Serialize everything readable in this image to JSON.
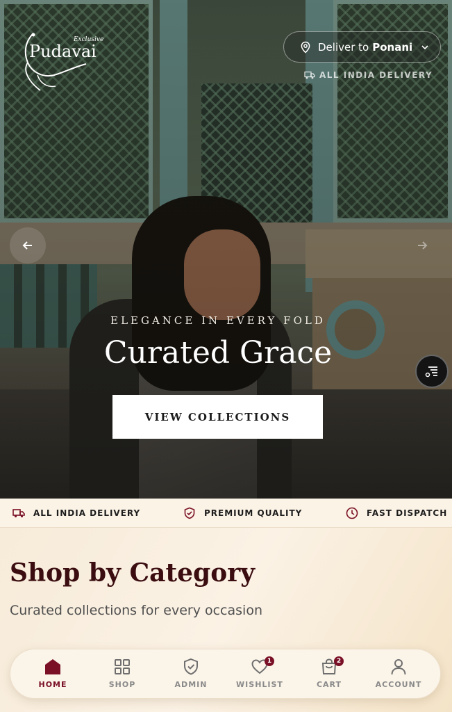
{
  "brand": {
    "exclusive": "Exclusive",
    "name": "Pudavai"
  },
  "header": {
    "deliver_prefix": "Deliver to",
    "deliver_location": "Ponani",
    "delivery_note": "ALL INDIA DELIVERY"
  },
  "hero": {
    "tagline": "ELEGANCE IN EVERY FOLD",
    "title": "Curated Grace",
    "cta_label": "VIEW COLLECTIONS"
  },
  "features": [
    {
      "label": "ALL INDIA DELIVERY",
      "icon": "truck-icon"
    },
    {
      "label": "PREMIUM QUALITY",
      "icon": "shield-icon"
    },
    {
      "label": "FAST DISPATCH",
      "icon": "clock-icon"
    }
  ],
  "category": {
    "title": "Shop by Category",
    "subtitle": "Curated collections for every occasion"
  },
  "bottom_nav": [
    {
      "label": "HOME",
      "icon": "home-icon",
      "active": true
    },
    {
      "label": "SHOP",
      "icon": "grid-icon"
    },
    {
      "label": "ADMIN",
      "icon": "shield-check-icon"
    },
    {
      "label": "WISHLIST",
      "icon": "heart-icon",
      "badge": "1"
    },
    {
      "label": "CART",
      "icon": "bag-icon",
      "badge": "2"
    },
    {
      "label": "ACCOUNT",
      "icon": "user-icon"
    }
  ],
  "colors": {
    "accent": "#7a1026",
    "heading": "#3b0d10",
    "nav_inactive": "#8a8a8a"
  }
}
